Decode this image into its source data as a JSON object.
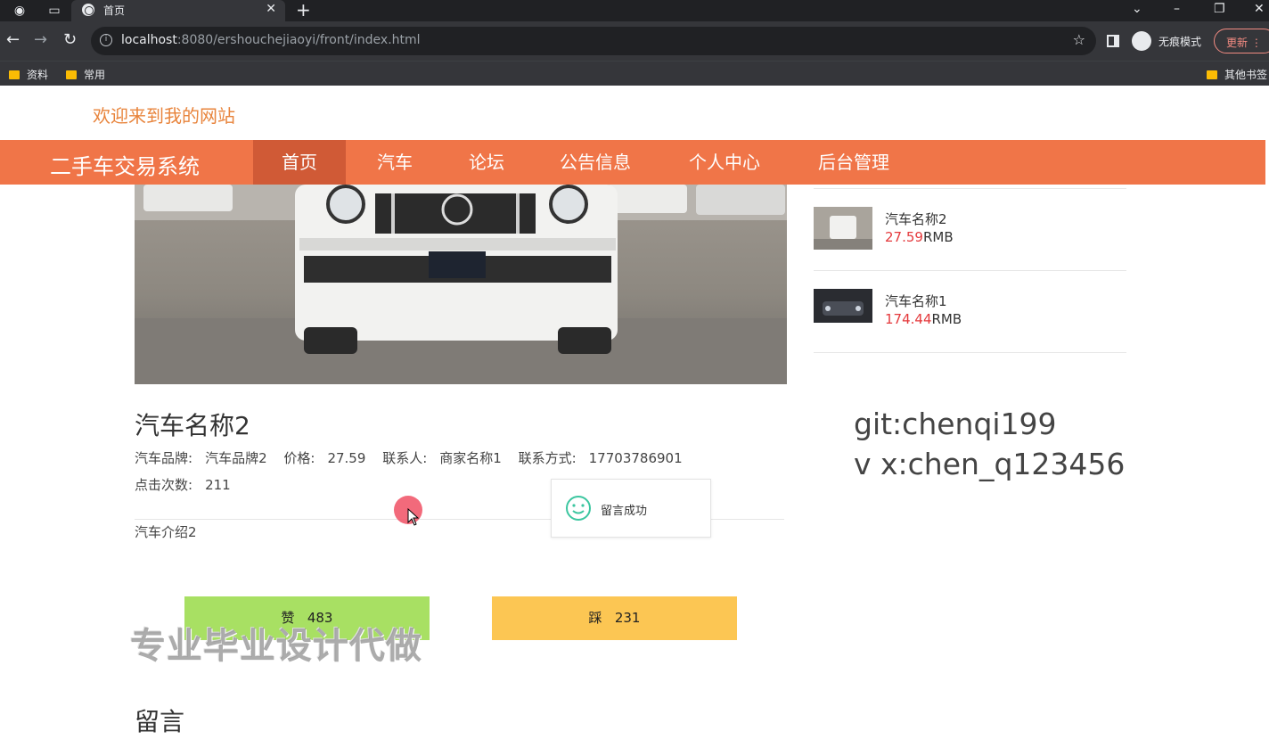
{
  "browser": {
    "tab_title": "首页",
    "url_host": "localhost",
    "url_rest": ":8080/ershouchejiaoyi/front/index.html",
    "incognito_label": "无痕模式",
    "update_label": "更新",
    "bookmarks": [
      "资料",
      "常用"
    ],
    "other_bookmarks": "其他书签"
  },
  "site": {
    "welcome": "欢迎来到我的网站",
    "brand": "二手车交易系统",
    "nav": [
      "首页",
      "汽车",
      "论坛",
      "公告信息",
      "个人中心",
      "后台管理"
    ],
    "active_nav": "首页"
  },
  "detail": {
    "name": "汽车名称2",
    "brand_label": "汽车品牌:",
    "brand": "汽车品牌2",
    "price_label": "价格:",
    "price": "27.59",
    "contact_label": "联系人:",
    "contact": "商家名称1",
    "phone_label": "联系方式:",
    "phone": "17703786901",
    "clicks_label": "点击次数:",
    "clicks": "211",
    "intro": "汽车介绍2",
    "like_label": "赞",
    "like_count": "483",
    "dislike_label": "踩",
    "dislike_count": "231",
    "comments_title": "留言"
  },
  "side_list": [
    {
      "name": "汽车名称2",
      "price": "27.59",
      "unit": "RMB"
    },
    {
      "name": "汽车名称1",
      "price": "174.44",
      "unit": "RMB"
    }
  ],
  "overlay": {
    "git": "git:chenqi199",
    "wx": "v x:chen_q123456",
    "watermark": "专业毕业设计代做",
    "toast": "留言成功"
  },
  "colors": {
    "nav_bg": "#f07548",
    "nav_active": "#d05a36",
    "price_red": "#e4393c",
    "like_green": "#a8e063",
    "dislike_yellow": "#fcc653"
  }
}
